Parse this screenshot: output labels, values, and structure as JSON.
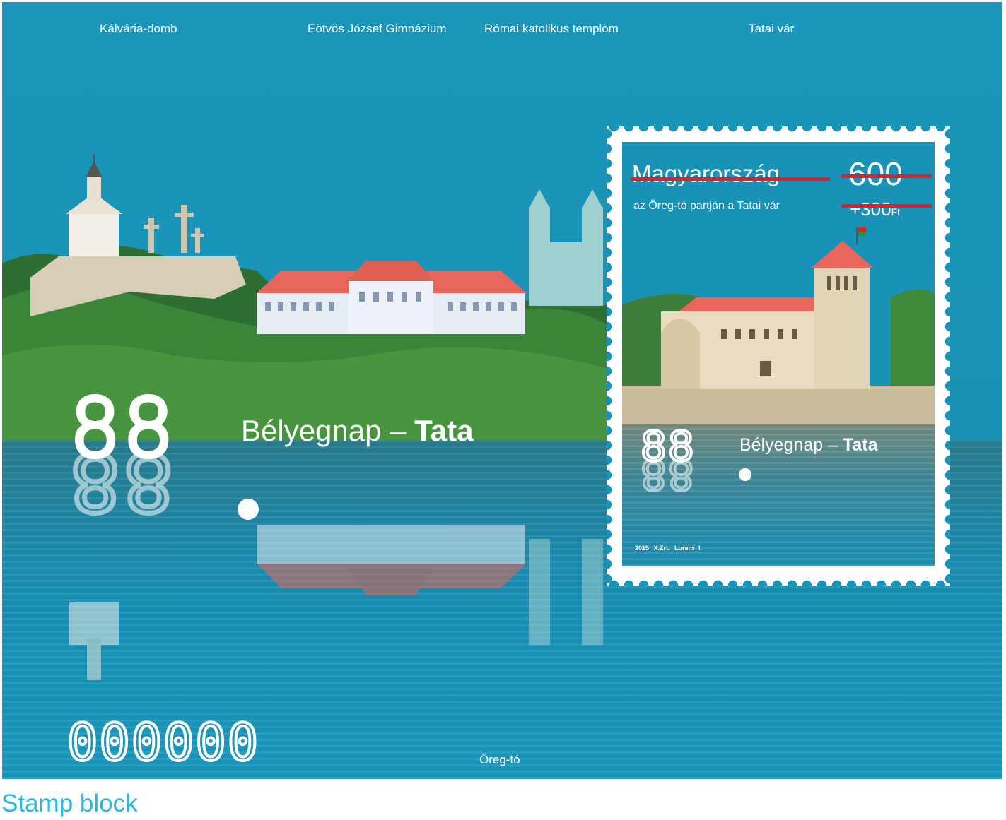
{
  "sheet": {
    "captions": {
      "hill": "Kálvária-domb",
      "school": "Eötvös József Gimnázium",
      "church": "Római katolikus templom",
      "castle": "Tatai vár"
    },
    "title_number": "88",
    "title_text": "Bélyegnap – ",
    "title_bold": "Tata",
    "serial": "000000",
    "lake_caption": "Öreg-tó"
  },
  "stamp": {
    "country": "Magyarország",
    "subtitle": "az Öreg-tó partján a Tatai vár",
    "value": "600",
    "surcharge": "+300",
    "currency": "Ft",
    "title_number": "88",
    "title_text": "Bélyegnap – ",
    "title_bold": "Tata",
    "credits": "2015  X.Zrt.  Lorem I."
  },
  "footer_caption": "Stamp block",
  "colors": {
    "sheet_blue": "#1794b9",
    "roof_red": "#e8675a",
    "strike_red": "#e41e26",
    "caption_cyan": "#29b7e3"
  }
}
